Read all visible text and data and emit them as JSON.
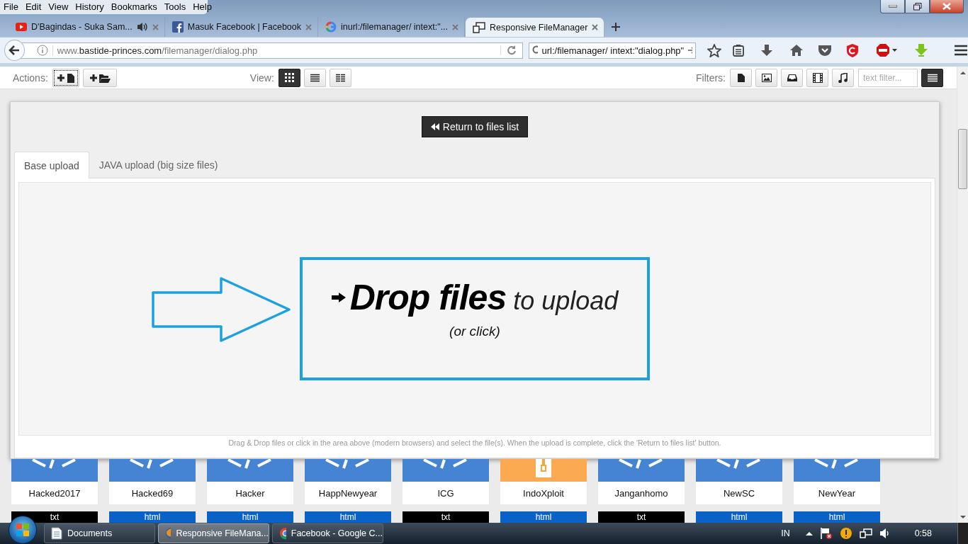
{
  "menu": [
    "File",
    "Edit",
    "View",
    "History",
    "Bookmarks",
    "Tools",
    "Help"
  ],
  "browser_tabs": [
    {
      "title": "D'Bagindas - Suka Sam...",
      "audio": true,
      "selected": false
    },
    {
      "title": "Masuk Facebook | Facebook",
      "audio": false,
      "selected": false
    },
    {
      "title": "inurl:/filemanager/ intext:\"...",
      "audio": false,
      "selected": false
    },
    {
      "title": "Responsive FileManager",
      "audio": false,
      "selected": true
    }
  ],
  "address": {
    "prefix": "www.",
    "domain": "bastide-princes.com",
    "path": "/filemanager/dialog.php"
  },
  "search": {
    "value": "url:/filemanager/ intext:\"dialog.php\""
  },
  "toolbar": {
    "actions_label": "Actions:",
    "view_label": "View:",
    "views": [
      {
        "selected": true
      },
      {
        "selected": false
      },
      {
        "selected": false
      }
    ],
    "filters_label": "Filters:",
    "filter_placeholder": "text filter..."
  },
  "dialog": {
    "return_button": "Return to files list",
    "tabs": [
      {
        "label": "Base upload",
        "selected": true
      },
      {
        "label": "JAVA upload (big size files)",
        "selected": false
      }
    ],
    "drop_title": "**Drop files** to upload",
    "drop_subtitle": "(or click)",
    "hint": "Drag & Drop files or click in the area above (modern browsers) and select the file(s). When the upload is complete, click the 'Return to files list' button."
  },
  "files": [
    {
      "name": "Hacked2017",
      "kind": "html"
    },
    {
      "name": "Hacked69",
      "kind": "html"
    },
    {
      "name": "Hacker",
      "kind": "html"
    },
    {
      "name": "HappNewyear",
      "kind": "html"
    },
    {
      "name": "ICG",
      "kind": "html"
    },
    {
      "name": "IndoXploit",
      "kind": "zip"
    },
    {
      "name": "Janganhomo",
      "kind": "html"
    },
    {
      "name": "NewSC",
      "kind": "html"
    },
    {
      "name": "NewYear",
      "kind": "html"
    }
  ],
  "next_files": [
    {
      "label": "txt",
      "kind": "txt"
    },
    {
      "label": "html",
      "kind": "html"
    },
    {
      "label": "html",
      "kind": "html"
    },
    {
      "label": "html",
      "kind": "html"
    },
    {
      "label": "txt",
      "kind": "txt"
    },
    {
      "label": "html",
      "kind": "html"
    },
    {
      "label": "txt",
      "kind": "txt"
    },
    {
      "label": "html",
      "kind": "html"
    },
    {
      "label": "html",
      "kind": "html"
    }
  ],
  "taskbar": {
    "items": [
      {
        "label": "Documents",
        "selected": false
      },
      {
        "label": "Responsive FileMana...",
        "selected": true
      },
      {
        "label": "Facebook - Google C...",
        "selected": false
      }
    ],
    "language": "IN",
    "clock": "0:58"
  }
}
